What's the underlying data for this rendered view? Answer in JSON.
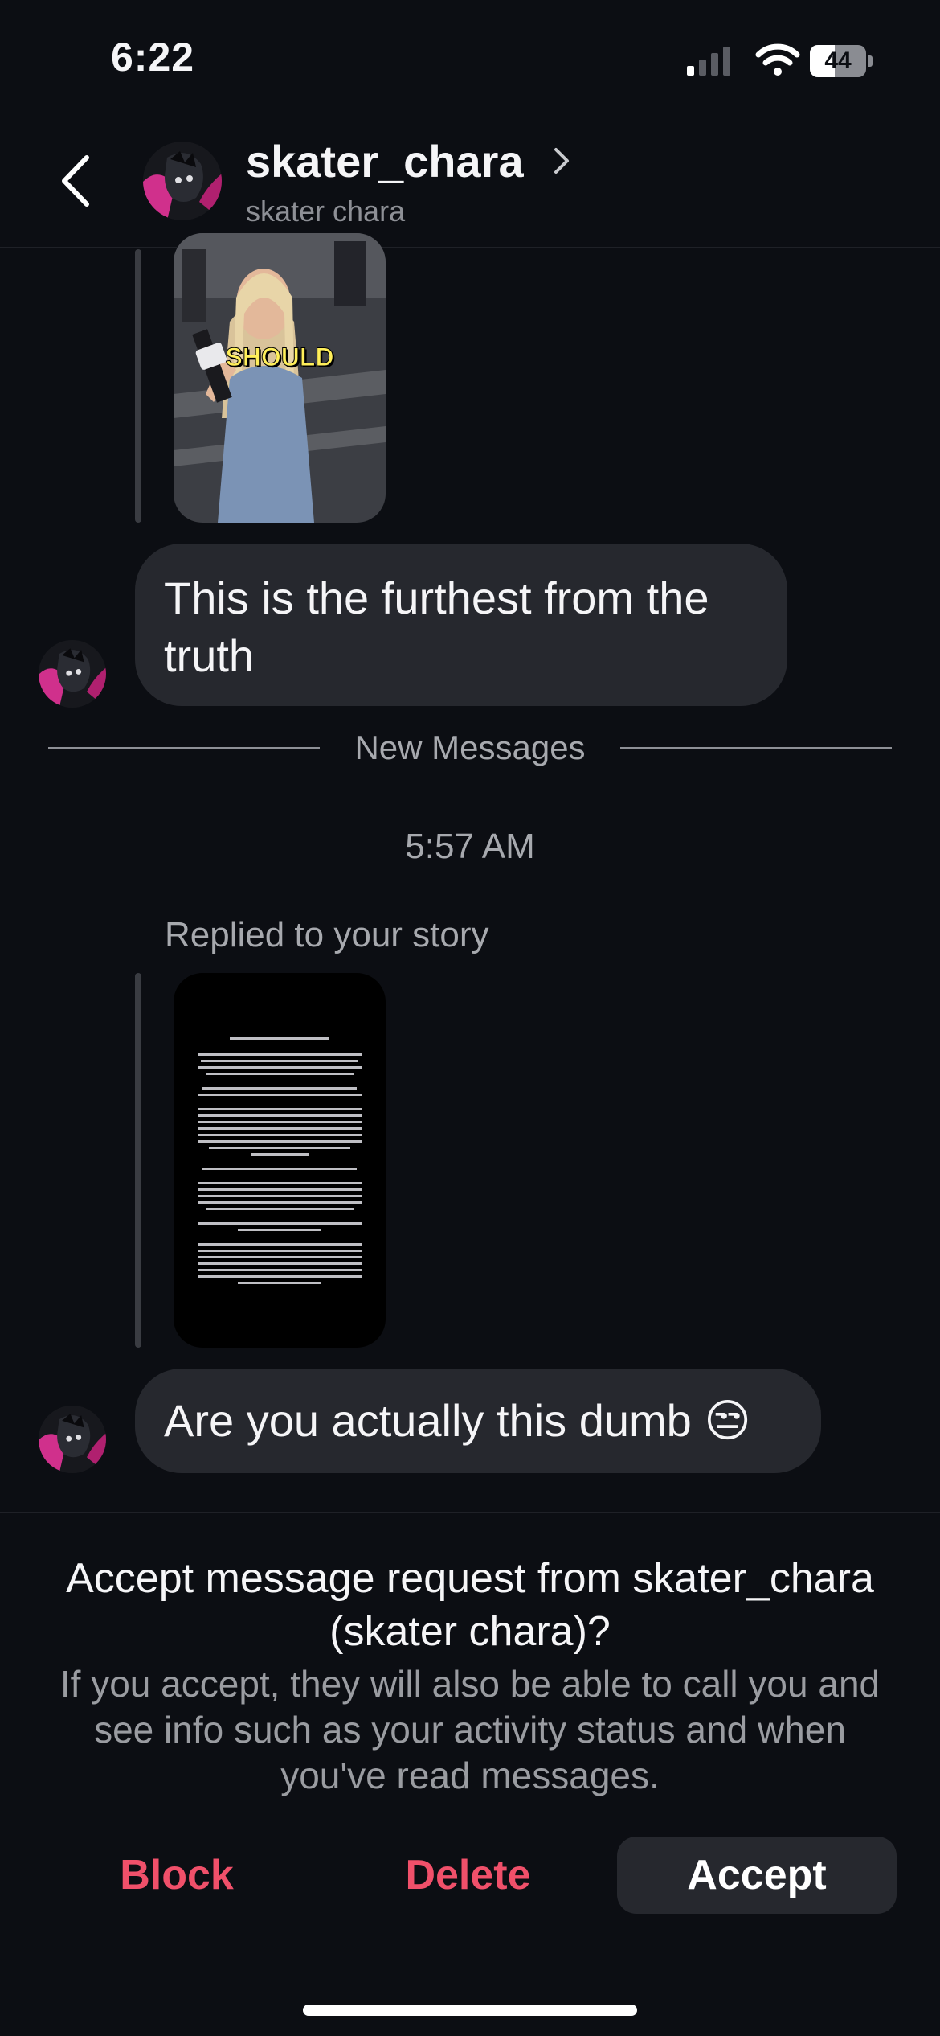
{
  "status_bar": {
    "time": "6:22",
    "battery": "44",
    "battery_level": 0.44
  },
  "header": {
    "username": "skater_chara",
    "display_name": "skater chara"
  },
  "messages": [
    {
      "type": "story_reply",
      "thumbnail_caption": "SHOULD"
    },
    {
      "type": "text",
      "text": "This is the furthest from the truth"
    }
  ],
  "divider": {
    "label": "New Messages"
  },
  "timestamp": "5:57 AM",
  "story_reply": {
    "label": "Replied to your story"
  },
  "message_2": {
    "text": "Are you actually this dumb 😒"
  },
  "request": {
    "title": "Accept message request from skater_chara (skater chara)?",
    "info": "If you accept, they will also be able to call you and see info such as your activity status and when you've read messages."
  },
  "actions": {
    "block": "Block",
    "delete": "Delete",
    "accept": "Accept"
  },
  "colors": {
    "background": "#0c0e13",
    "bubble": "#26282e",
    "destructive": "#f0506a"
  }
}
